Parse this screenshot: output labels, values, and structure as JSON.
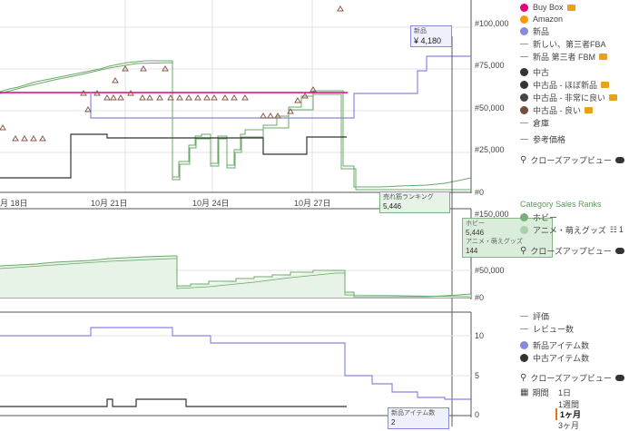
{
  "chart_main": {
    "y_ticks": [
      "#100,000",
      "#75,000",
      "#50,000",
      "#25,000",
      "#0"
    ],
    "x_ticks": [
      "月 18日",
      "10月 21日",
      "10月 24日",
      "10月 27日"
    ]
  },
  "chart_rank": {
    "y_ticks": [
      "#150,000",
      "#50,000",
      "#0"
    ]
  },
  "chart_count": {
    "y_ticks": [
      "10",
      "5",
      "0"
    ]
  },
  "tooltips": {
    "new_label": "新品",
    "new_value": "¥ 4,180",
    "rank_label": "売れ筋ランキング",
    "rank_value": "5,446",
    "hobby_label": "ホビー",
    "hobby_value": "5,446",
    "anime_label": "アニメ・萌えグッズ",
    "anime_value": "144",
    "count_label": "新品アイテム数",
    "count_value": "2"
  },
  "legend_price": {
    "items": [
      {
        "label": "Buy Box",
        "color": "#e6007e",
        "marker": "dot",
        "cart": true
      },
      {
        "label": "Amazon",
        "color": "#ff9900",
        "marker": "dot",
        "cart": false
      },
      {
        "label": "新品",
        "color": "#8888dd",
        "marker": "dot",
        "cart": false
      },
      {
        "label": "新しい、第三者FBA",
        "color": "#999999",
        "marker": "dash",
        "cart": false
      },
      {
        "label": "新品 第三者 FBM",
        "color": "#999999",
        "marker": "dash",
        "cart": true
      },
      {
        "label": "中古",
        "color": "#333333",
        "marker": "dot",
        "cart": false
      },
      {
        "label": "中古品 - ほぼ新品",
        "color": "#333333",
        "marker": "dot",
        "cart": true
      },
      {
        "label": "中古品 - 非常に良い",
        "color": "#444444",
        "marker": "dot",
        "cart": true
      },
      {
        "label": "中古品 - 良い",
        "color": "#7a4a3a",
        "marker": "dot",
        "cart": true
      },
      {
        "label": "倉庫",
        "color": "#999999",
        "marker": "dash",
        "cart": false
      },
      {
        "label": "参考価格",
        "color": "#999999",
        "marker": "dash",
        "cart": false
      }
    ],
    "closeup_label": "クローズアップビュー"
  },
  "legend_rank": {
    "title": "Category Sales Ranks",
    "items": [
      {
        "label": "ホビー",
        "color": "#7cae7c"
      },
      {
        "label": "アニメ・萌えグッズ",
        "color": "#a9d2a9",
        "suffix": "1"
      }
    ],
    "closeup_label": "クローズアップビュー"
  },
  "legend_count": {
    "items": [
      {
        "label": "評価",
        "color": "#999999",
        "marker": "dash"
      },
      {
        "label": "レビュー数",
        "color": "#999999",
        "marker": "dash"
      },
      {
        "label": "新品アイテム数",
        "color": "#8888dd",
        "marker": "dot"
      },
      {
        "label": "中古アイテム数",
        "color": "#333333",
        "marker": "dot"
      }
    ],
    "closeup_label": "クローズアップビュー"
  },
  "range": {
    "label": "期間",
    "options": [
      "1日",
      "1週間",
      "1ヶ月",
      "3ヶ月"
    ],
    "selected": "1ヶ月"
  },
  "colors": {
    "buybox": "#e6007e",
    "new": "#8888dd",
    "used": "#333333",
    "rank": "#7cae7c",
    "accent": "#e8740c"
  }
}
